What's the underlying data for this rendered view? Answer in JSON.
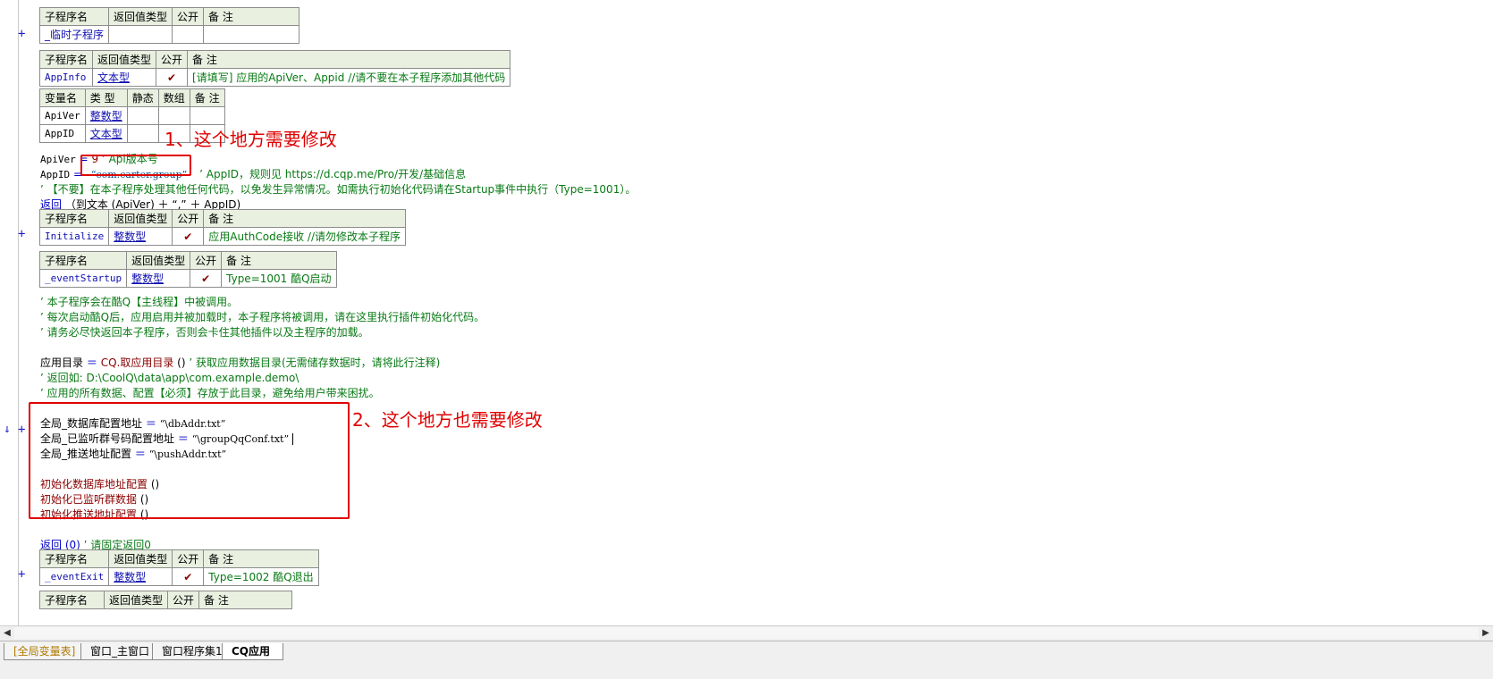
{
  "tables": {
    "t1": {
      "headers": [
        "子程序名",
        "返回值类型",
        "公开",
        "备 注"
      ],
      "row": {
        "name": "_临时子程序",
        "type": "",
        "public": "",
        "note": ""
      }
    },
    "t2": {
      "headers": [
        "子程序名",
        "返回值类型",
        "公开",
        "备 注"
      ],
      "row": {
        "name": "AppInfo",
        "type": "文本型",
        "public": "✔",
        "note": "[请填写] 应用的ApiVer、Appid //请不要在本子程序添加其他代码"
      }
    },
    "vars": {
      "headers": [
        "变量名",
        "类 型",
        "静态",
        "数组",
        "备 注"
      ],
      "rows": [
        {
          "name": "ApiVer",
          "type": "整数型"
        },
        {
          "name": "AppID",
          "type": "文本型"
        }
      ]
    },
    "t3": {
      "headers": [
        "子程序名",
        "返回值类型",
        "公开",
        "备 注"
      ],
      "row": {
        "name": "Initialize",
        "type": "整数型",
        "public": "✔",
        "note": "应用AuthCode接收 //请勿修改本子程序"
      }
    },
    "t4": {
      "headers": [
        "子程序名",
        "返回值类型",
        "公开",
        "备 注"
      ],
      "row": {
        "name": "_eventStartup",
        "type": "整数型",
        "public": "✔",
        "note": "Type=1001 酷Q启动"
      }
    },
    "t5": {
      "headers": [
        "子程序名",
        "返回值类型",
        "公开",
        "备 注"
      ],
      "row": {
        "name": "_eventExit",
        "type": "整数型",
        "public": "✔",
        "note": "Type=1002 酷Q退出"
      }
    },
    "t6": {
      "headers": [
        "子程序名",
        "返回值类型",
        "公开",
        "备 注"
      ]
    }
  },
  "code": {
    "apiver_lhs": "ApiVer",
    "apiver_op": "=",
    "apiver_val": "9",
    "apiver_comment": "’ Api版本号",
    "appid_lhs": "AppID",
    "appid_op": "=",
    "appid_val": "“com.carter.group”",
    "appid_comment": "’ AppID，规则见 https://d.cqp.me/Pro/开发/基础信息",
    "warn_comment": "’ 【不要】在本子程序处理其他任何代码，以免发生异常情况。如需执行初始化代码请在Startup事件中执行（Type=1001）。",
    "return1_kw": "返回",
    "return1_rest": "（到文本 (ApiVer) ＋ “,” ＋ AppID)",
    "startup_c1": "’ 本子程序会在酷Q【主线程】中被调用。",
    "startup_c2": "’ 每次启动酷Q后，应用启用并被加载时，本子程序将被调用，请在这里执行插件初始化代码。",
    "startup_c3": "’ 请务必尽快返回本子程序，否则会卡住其他插件以及主程序的加载。",
    "appdir_lhs": "应用目录",
    "appdir_op": "＝",
    "appdir_fn": "CQ.取应用目录",
    "appdir_paren": "()",
    "appdir_comment": "’ 获取应用数据目录(无需储存数据时，请将此行注释)",
    "appdir_c2": "’ 返回如: D:\\CoolQ\\data\\app\\com.example.demo\\",
    "appdir_c3": "’ 应用的所有数据、配置【必须】存放于此目录，避免给用户带来困扰。",
    "g1_lhs": "全局_数据库配置地址",
    "g1_op": "＝",
    "g1_val": "“\\dbAddr.txt”",
    "g2_lhs": "全局_已监听群号码配置地址",
    "g2_op": "＝",
    "g2_val": "“\\groupQqConf.txt”",
    "g3_lhs": "全局_推送地址配置",
    "g3_op": "＝",
    "g3_val": "“\\pushAddr.txt”",
    "init1": "初始化数据库地址配置",
    "init2": "初始化已监听群数据",
    "init3": "初始化推送地址配置",
    "paren": "()",
    "return2_kw": "返回",
    "return2_rest": "(0)",
    "return2_comment": "’ 请固定返回0"
  },
  "annotations": {
    "a1": "1、这个地方需要修改",
    "a2": "2、这个地方也需要修改"
  },
  "markers": {
    "plus": "+",
    "arrow": "↓"
  },
  "scrollbar": {
    "left": "◀",
    "right": "▶"
  },
  "tabs": [
    "[全局变量表]",
    "窗口_主窗口",
    "窗口程序集1",
    "CQ应用"
  ],
  "colors": {
    "annotation": "#e00000",
    "keyword": "#0000c8",
    "comment": "#087a14",
    "header_bg": "#e9f0e0"
  }
}
